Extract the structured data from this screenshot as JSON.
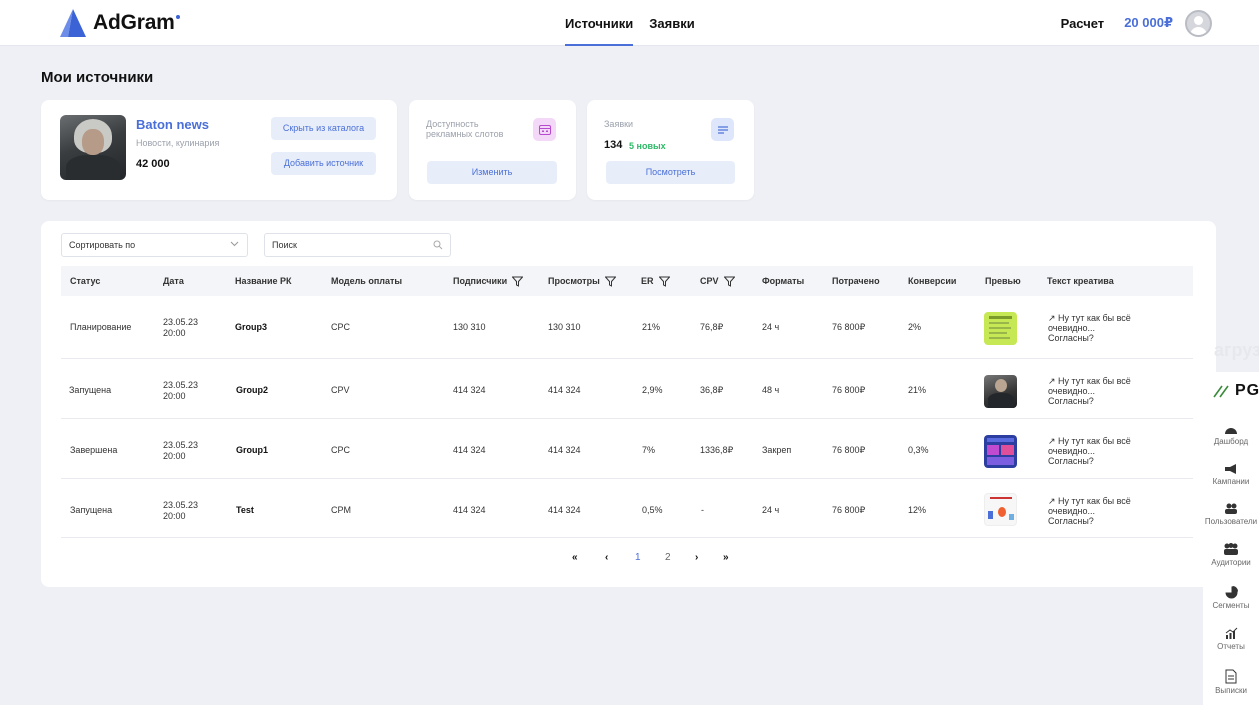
{
  "header": {
    "logo_text": "AdGram",
    "tabs": [
      {
        "label": "Источники",
        "active": true
      },
      {
        "label": "Заявки",
        "active": false
      }
    ],
    "raschet_label": "Расчет",
    "balance": "20 000₽"
  },
  "page_title": "Мои источники",
  "source_card": {
    "name": "Baton news",
    "category": "Новости, кулинария",
    "count": "42 000",
    "hide_button": "Скрыть из каталога",
    "add_button": "Добавить источник"
  },
  "slots_card": {
    "label": "Доступность рекламных слотов",
    "button": "Изменить"
  },
  "requests_card": {
    "label": "Заявки",
    "count": "134",
    "new_text": "5 новых",
    "button": "Посмотреть"
  },
  "filters": {
    "sort_value": "Сортировать по",
    "search_placeholder": "Поиск"
  },
  "table": {
    "columns": [
      "Статус",
      "Дата",
      "Название РК",
      "Модель оплаты",
      "Подписчики",
      "Просмотры",
      "ER",
      "CPV",
      "Форматы",
      "Потрачено",
      "Конверсии",
      "Превью",
      "Текст креатива"
    ],
    "rows": [
      {
        "status": "Планирование",
        "date1": "23.05.23",
        "date2": "20:00",
        "name": "Group3",
        "model": "CPC",
        "subs": "130 310",
        "views": "130 310",
        "er": "21%",
        "cpv": "76,8₽",
        "format": "24 ч",
        "spent": "76 800₽",
        "conv": "2%",
        "text1": "Ну тут как бы всё",
        "text2": "очевидно...",
        "text3": "Согласны?"
      },
      {
        "status": "Запущена",
        "date1": "23.05.23",
        "date2": "20:00",
        "name": "Group2",
        "model": "CPV",
        "subs": "414 324",
        "views": "414 324",
        "er": "2,9%",
        "cpv": "36,8₽",
        "format": "48 ч",
        "spent": "76 800₽",
        "conv": "21%",
        "text1": "Ну тут как бы всё",
        "text2": "очевидно...",
        "text3": "Согласны?"
      },
      {
        "status": "Завершена",
        "date1": "23.05.23",
        "date2": "20:00",
        "name": "Group1",
        "model": "CPC",
        "subs": "414 324",
        "views": "414 324",
        "er": "7%",
        "cpv": "1336,8₽",
        "format": "Закреп",
        "spent": "76 800₽",
        "conv": "0,3%",
        "text1": "Ну тут как бы всё",
        "text2": "очевидно...",
        "text3": "Согласны?"
      },
      {
        "status": "Запущена",
        "date1": "23.05.23",
        "date2": "20:00",
        "name": "Test",
        "model": "CPM",
        "subs": "414 324",
        "views": "414 324",
        "er": "0,5%",
        "cpv": "-",
        "format": "24 ч",
        "spent": "76 800₽",
        "conv": "12%",
        "text1": "Ну тут как бы всё",
        "text2": "очевидно...",
        "text3": "Согласны?"
      }
    ]
  },
  "pagination": {
    "first": "«",
    "prev": "‹",
    "pages": [
      "1",
      "2"
    ],
    "current": "1",
    "next": "›",
    "last": "»"
  },
  "right_sidebar": {
    "brand": "PG",
    "ghost_text": "агруз",
    "items": [
      "Дашборд",
      "Кампании",
      "Пользователи",
      "Аудитории",
      "Сегменты",
      "Отчеты",
      "Выписки"
    ]
  },
  "colors": {
    "accent": "#4a6fd8",
    "background": "#eef0f5",
    "new_green": "#2eb867",
    "button_light": "#e8eef9"
  }
}
